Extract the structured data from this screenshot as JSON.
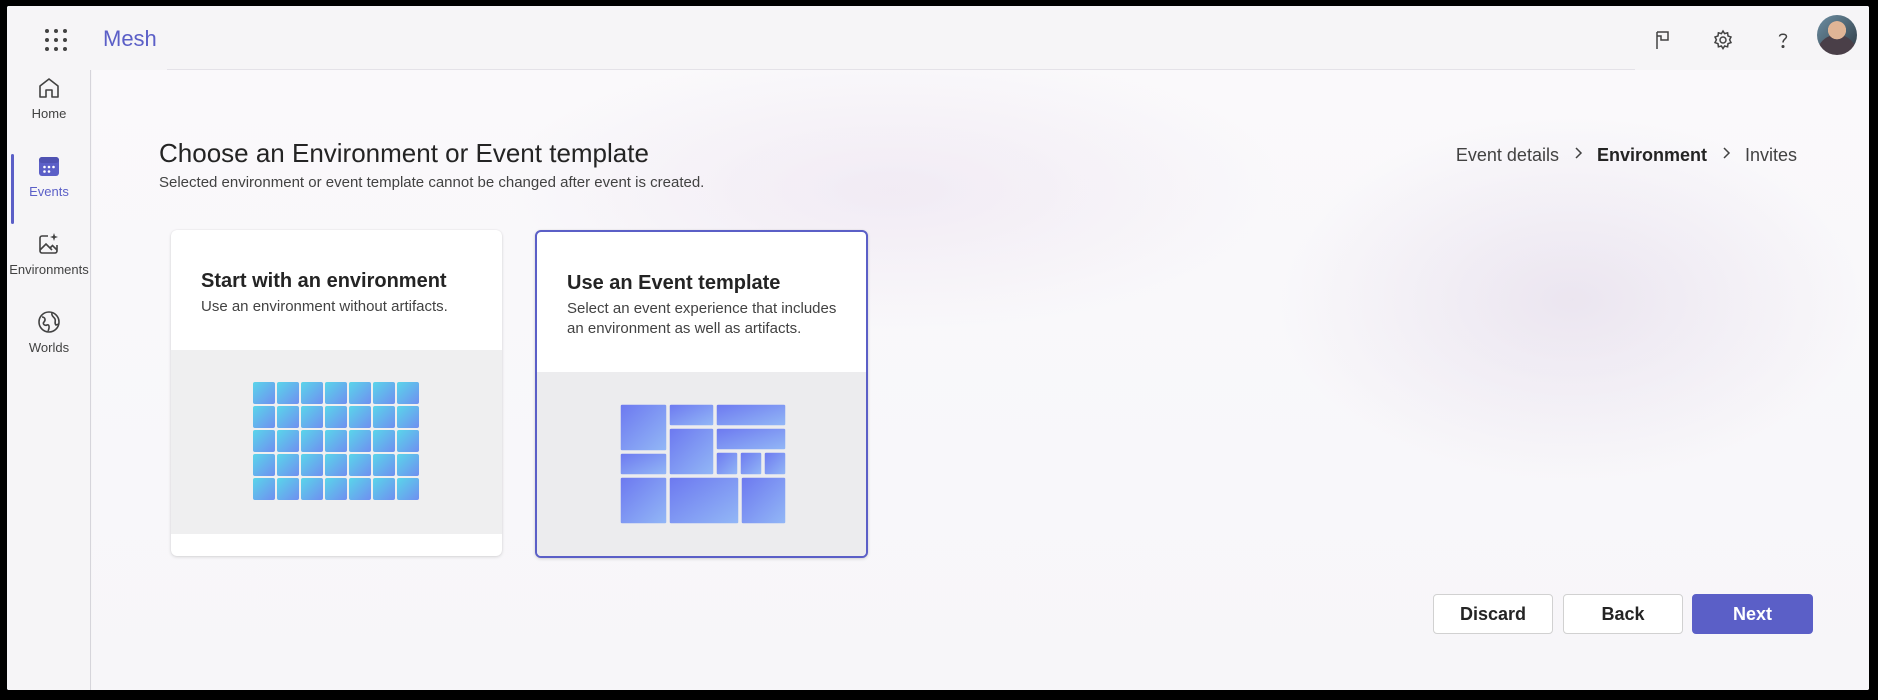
{
  "app": {
    "name": "Mesh"
  },
  "rail": {
    "items": [
      {
        "label": "Home"
      },
      {
        "label": "Events"
      },
      {
        "label": "Environments"
      },
      {
        "label": "Worlds"
      }
    ]
  },
  "page": {
    "title": "Choose an Environment or Event template",
    "subtitle": "Selected environment or event template cannot be changed after event is created."
  },
  "breadcrumb": {
    "steps": [
      "Event details",
      "Environment",
      "Invites"
    ],
    "current_index": 1
  },
  "cards": [
    {
      "title": "Start with an environment",
      "description": "Use an environment without artifacts.",
      "selected": false
    },
    {
      "title": "Use an Event template",
      "description": "Select an event experience that includes an environment as well as artifacts.",
      "selected": true
    }
  ],
  "actions": {
    "discard": "Discard",
    "back": "Back",
    "next": "Next"
  },
  "colors": {
    "accent": "#5b5fc7"
  }
}
